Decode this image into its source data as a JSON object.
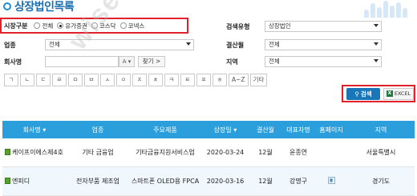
{
  "page": {
    "title": "상장법인목록"
  },
  "filters": {
    "market_label": "시장구분",
    "market_options": [
      "전체",
      "유가증권",
      "코스닥",
      "코넥스"
    ],
    "market_selected": "유가증권",
    "industry_label": "업종",
    "industry_value": "전체",
    "name_label": "회사명",
    "name_value": "",
    "name_alpha": "A",
    "find_label": "찾기 >",
    "search_type_label": "검색유형",
    "search_type_value": "상장법인",
    "settle_label": "결산월",
    "settle_value": "전체",
    "region_label": "지역",
    "region_value": "전체"
  },
  "consonants": [
    "ㄱ",
    "ㄴ",
    "ㄷ",
    "ㄹ",
    "ㅁ",
    "ㅂ",
    "ㅅ",
    "ㅇ",
    "ㅈ",
    "ㅊ",
    "ㅋ",
    "ㅌ",
    "ㅍ",
    "ㅎ",
    "A~Z",
    "기타"
  ],
  "actions": {
    "search_label": "검색",
    "excel_label": "EXCEL"
  },
  "table": {
    "headers": [
      "회사명 ▾",
      "업종",
      "주요제품",
      "상장일 ▾",
      "결산월",
      "대표자명",
      "홈페이지",
      "지역"
    ],
    "rows": [
      {
        "name": "케이프이에스제4호",
        "industry": "기타 금융업",
        "product": "기타금융지원서비스업",
        "listed": "2020-03-24",
        "settle": "12월",
        "ceo": "윤종연",
        "homepage": false,
        "region": "서울특별시"
      },
      {
        "name": "엔피디",
        "industry": "전자부품 제조업",
        "product": "스마트폰 OLED용 FPCA",
        "listed": "2020-03-16",
        "settle": "12월",
        "ceo": "강명구",
        "homepage": true,
        "region": "경기도"
      }
    ]
  },
  "watermark": "wisenrich.com",
  "colors": {
    "accent": "#1a8fd0",
    "header_bg": "#2a9fdc",
    "highlight": "#e0202a",
    "search_btn": "#1976b8"
  }
}
